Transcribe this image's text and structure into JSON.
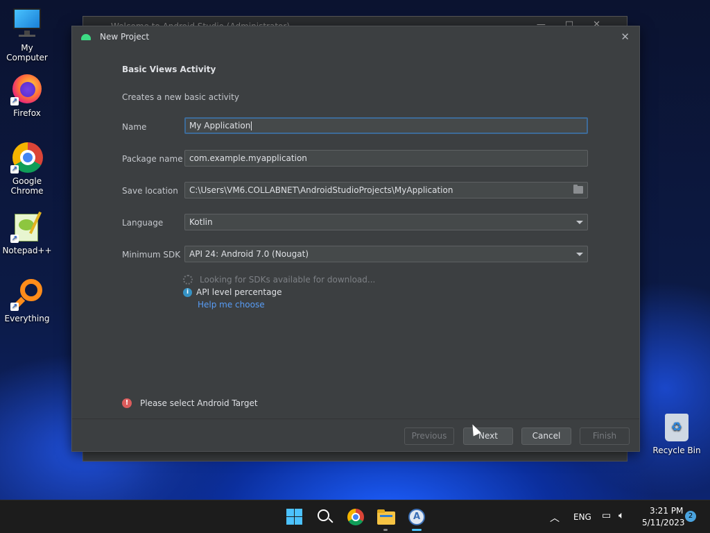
{
  "desktop": {
    "icons": [
      {
        "label": "My Computer"
      },
      {
        "label": "Firefox"
      },
      {
        "label": "Google Chrome"
      },
      {
        "label": "Notepad++"
      },
      {
        "label": "Everything"
      }
    ],
    "recycle_bin": "Recycle Bin"
  },
  "background_window": {
    "title": "Welcome to Android Studio (Administrator)"
  },
  "dialog": {
    "title": "New Project",
    "heading": "Basic Views Activity",
    "description": "Creates a new basic activity",
    "fields": {
      "name": {
        "label": "Name",
        "value": "My Application"
      },
      "package": {
        "label": "Package name",
        "value": "com.example.myapplication"
      },
      "location": {
        "label": "Save location",
        "value": "C:\\Users\\VM6.COLLABNET\\AndroidStudioProjects\\MyApplication"
      },
      "language": {
        "label": "Language",
        "value": "Kotlin"
      },
      "min_sdk": {
        "label": "Minimum SDK",
        "value": "API 24: Android 7.0 (Nougat)"
      }
    },
    "status": {
      "loading": "Looking for SDKs available for download...",
      "api_level": "API level percentage",
      "help_link": "Help me choose",
      "error": "Please select Android Target"
    },
    "buttons": {
      "previous": "Previous",
      "next": "Next",
      "cancel": "Cancel",
      "finish": "Finish"
    }
  },
  "taskbar": {
    "language": "ENG",
    "time": "3:21 PM",
    "date": "5/11/2023",
    "notifications": "2"
  },
  "colors": {
    "dialog_bg": "#3c3f41",
    "field_bg": "#45494a",
    "focus_border": "#3d6b99",
    "link": "#589df6",
    "error": "#db5c5c",
    "info": "#3592c4"
  }
}
